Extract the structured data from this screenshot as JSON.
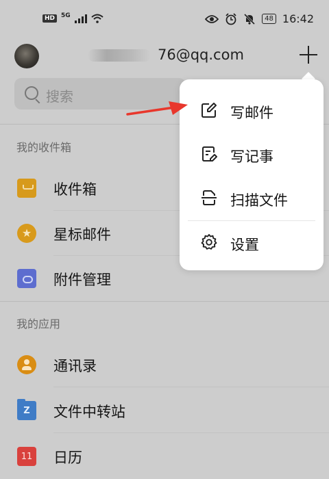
{
  "status_bar": {
    "hd": "HD",
    "network": "5G",
    "battery": "48",
    "time": "16:42"
  },
  "header": {
    "email": "76@qq.com"
  },
  "search": {
    "placeholder": "搜索"
  },
  "inbox_section": {
    "title": "我的收件箱",
    "items": [
      {
        "label": "收件箱",
        "icon": "inbox-tray-icon",
        "color": "#d79a1c"
      },
      {
        "label": "星标邮件",
        "icon": "star-icon",
        "color": "#d89a1c"
      },
      {
        "label": "附件管理",
        "icon": "attachment-icon",
        "color": "#5d6dcf"
      }
    ]
  },
  "apps_section": {
    "title": "我的应用",
    "items": [
      {
        "label": "通讯录",
        "icon": "contacts-icon",
        "color": "#d98d14"
      },
      {
        "label": "文件中转站",
        "icon": "folder-icon",
        "badge": "Z",
        "color": "#3f7cc6"
      },
      {
        "label": "日历",
        "icon": "calendar-icon",
        "badge": "11",
        "color": "#d9413d"
      }
    ]
  },
  "popup_menu": {
    "items": [
      {
        "label": "写邮件",
        "icon": "compose-pen-icon"
      },
      {
        "label": "写记事",
        "icon": "note-edit-icon"
      },
      {
        "label": "扫描文件",
        "icon": "scan-document-icon"
      },
      {
        "label": "设置",
        "icon": "gear-icon"
      }
    ]
  },
  "annotation": {
    "arrow_color": "#e8372c"
  }
}
